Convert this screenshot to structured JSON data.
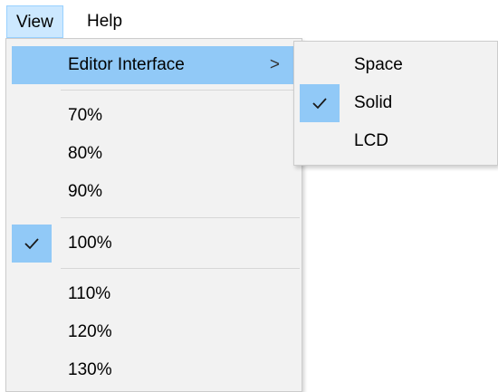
{
  "menubar": {
    "view_label": "View",
    "help_label": "Help"
  },
  "view_menu": {
    "editor_interface_label": "Editor Interface",
    "submenu_arrow": ">",
    "zoom_70": "70%",
    "zoom_80": "80%",
    "zoom_90": "90%",
    "zoom_100": "100%",
    "zoom_110": "110%",
    "zoom_120": "120%",
    "zoom_130": "130%",
    "checked_zoom": "100%"
  },
  "editor_interface_submenu": {
    "space_label": "Space",
    "solid_label": "Solid",
    "lcd_label": "LCD",
    "checked": "Solid"
  },
  "colors": {
    "highlight": "#91c9f7",
    "menu_background": "#f2f2f2",
    "menubar_active": "#cce8ff"
  }
}
